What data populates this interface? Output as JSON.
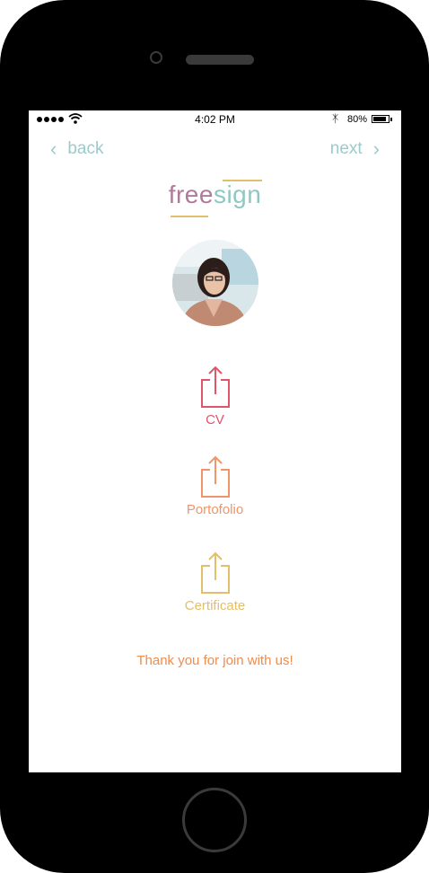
{
  "status_bar": {
    "time": "4:02 PM",
    "battery_percent": "80%",
    "battery_level": 0.8
  },
  "nav": {
    "back_label": "back",
    "next_label": "next",
    "back_icon": "chevron-left-icon",
    "next_icon": "chevron-right-icon"
  },
  "logo": {
    "part1": "free",
    "part2": "sign",
    "colors": {
      "free": "#b07a9a",
      "sign": "#8fc7c3",
      "accent_lines": "#e2bf6b"
    }
  },
  "uploads": [
    {
      "label": "CV",
      "icon": "upload-icon",
      "color": "#e0556a"
    },
    {
      "label": "Portofolio",
      "icon": "upload-icon",
      "color": "#f0956a"
    },
    {
      "label": "Certificate",
      "icon": "upload-icon",
      "color": "#e2bf6b"
    }
  ],
  "thanks_message": "Thank you for join with us!"
}
